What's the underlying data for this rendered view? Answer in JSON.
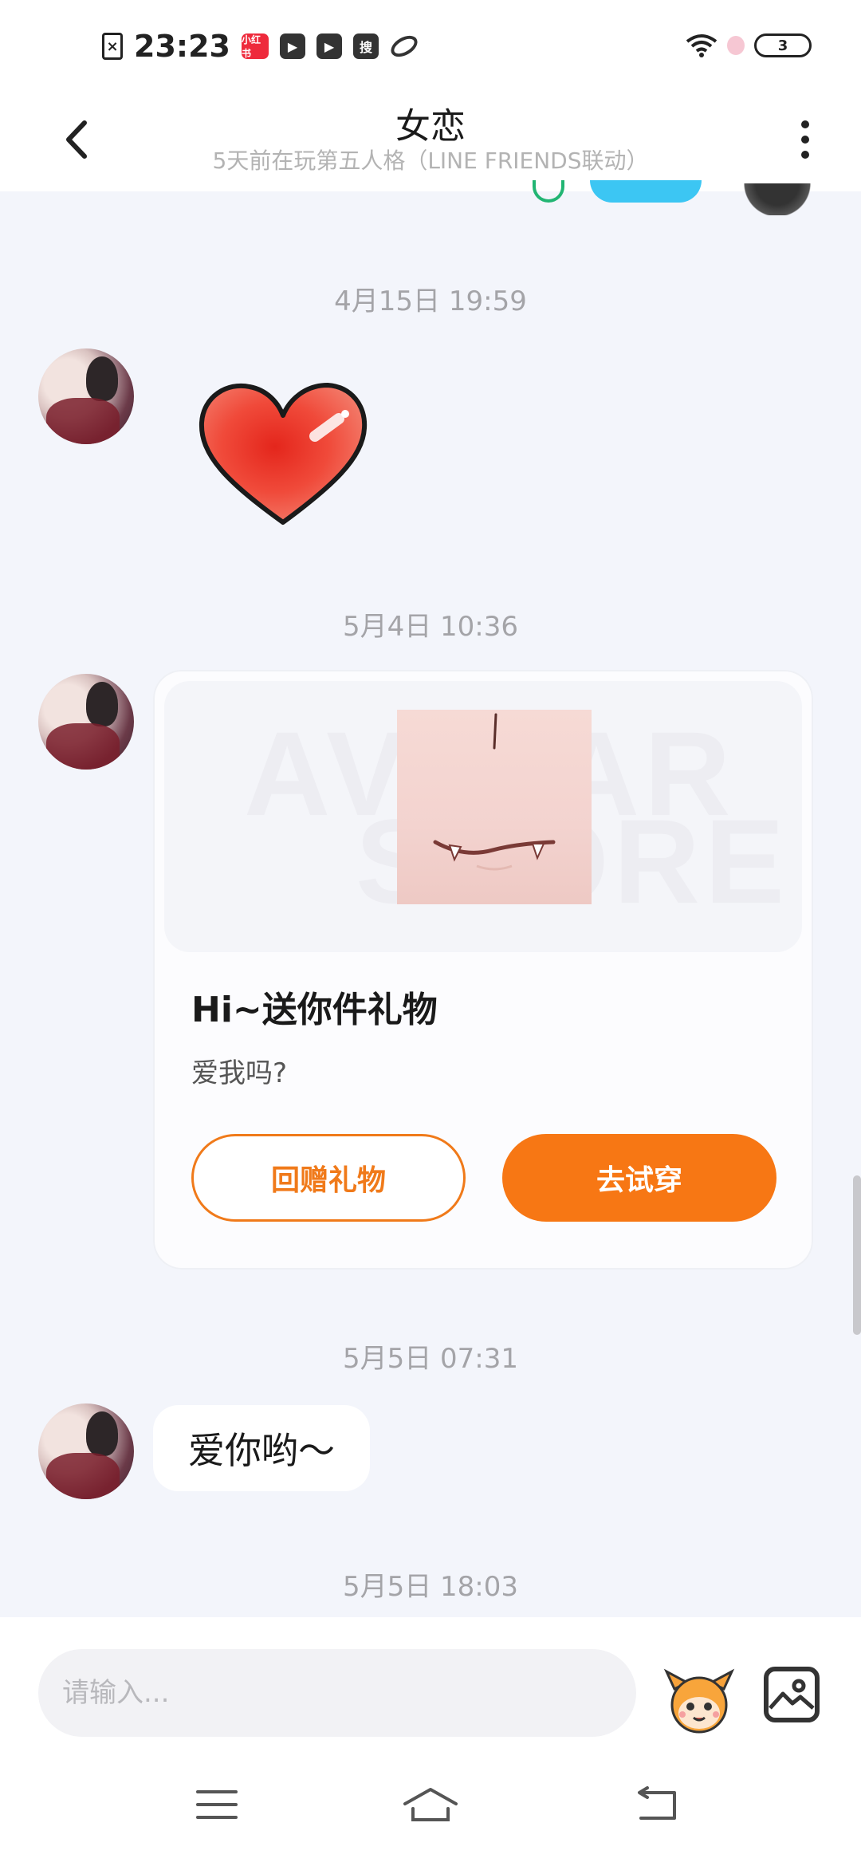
{
  "status_bar": {
    "time": "23:23",
    "app_badge": "小红书",
    "search_badge": "搜",
    "battery": "3"
  },
  "header": {
    "title": "女恋",
    "subtitle": "5天前在玩第五人格（LINE FRIENDS联动）"
  },
  "messages": {
    "ts1": "4月15日 19:59",
    "ts2": "5月4日 10:36",
    "ts3": "5月5日 07:31",
    "ts4": "5月5日 18:03",
    "text_message": "爱你哟～"
  },
  "gift_card": {
    "watermark_top": "AVATAR",
    "watermark_bottom": "STORE",
    "title": "Hi~送你件礼物",
    "description": "爱我吗?",
    "return_gift_label": "回赠礼物",
    "try_on_label": "去试穿",
    "accent_color": "#f77714"
  },
  "input_bar": {
    "placeholder": "请输入..."
  },
  "icons": {
    "back": "chevron-left-icon",
    "more": "more-vertical-icon",
    "emoji": "mascot-emoji-icon",
    "image": "image-icon",
    "menu": "menu-icon",
    "home": "home-icon",
    "back_nav": "back-nav-icon"
  }
}
